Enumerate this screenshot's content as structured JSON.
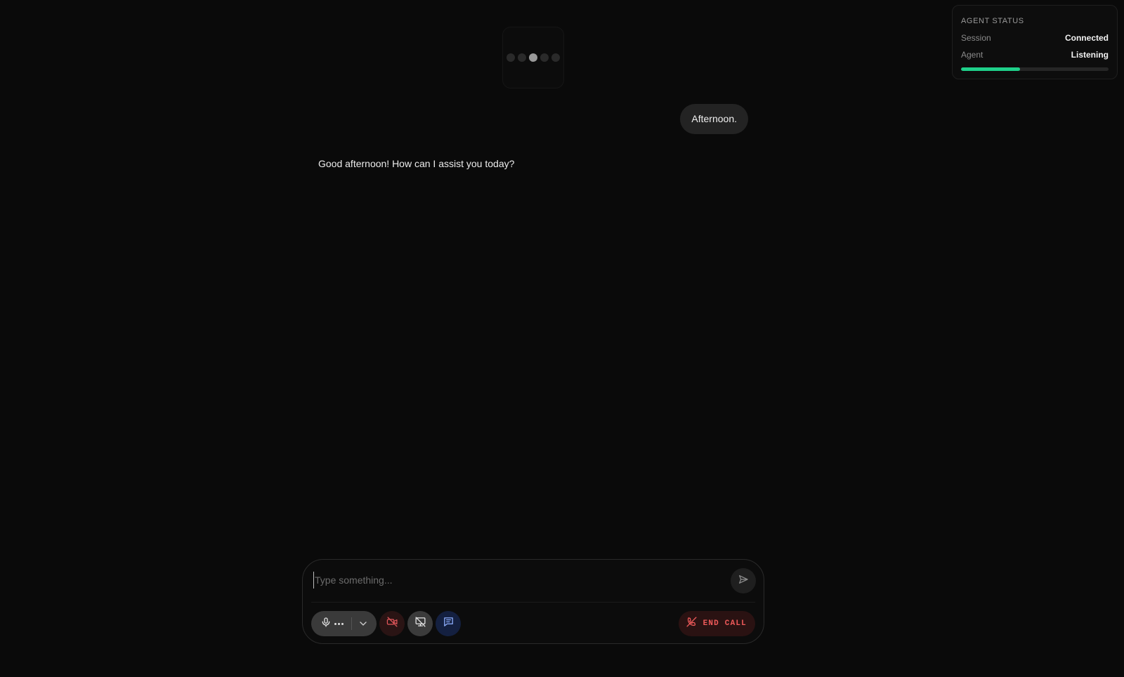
{
  "status_panel": {
    "title": "AGENT STATUS",
    "rows": [
      {
        "key": "Session",
        "value": "Connected"
      },
      {
        "key": "Agent",
        "value": "Listening"
      }
    ],
    "progress": 0.4,
    "progress_color": "#1fd08a"
  },
  "visualizer": {
    "dots": 5,
    "active_index": 2
  },
  "chat": {
    "messages": [
      {
        "role": "user",
        "text": "Afternoon."
      },
      {
        "role": "agent",
        "text": "Good afternoon! How can I assist you today?"
      }
    ]
  },
  "composer": {
    "placeholder": "Type something...",
    "value": "",
    "send_icon": "send-icon",
    "controls": {
      "mic_icon": "microphone-icon",
      "device_menu_icon": "chevron-down-icon",
      "camera_icon": "camera-off-icon",
      "screen_share_icon": "screen-share-off-icon",
      "chat_icon": "chat-icon"
    },
    "end_call_label": "END CALL",
    "end_call_icon": "phone-off-icon"
  },
  "colors": {
    "background": "#0a0a0a",
    "accent_green": "#1fd08a",
    "danger_red": "#f05a5a",
    "chat_blue": "#142040"
  }
}
